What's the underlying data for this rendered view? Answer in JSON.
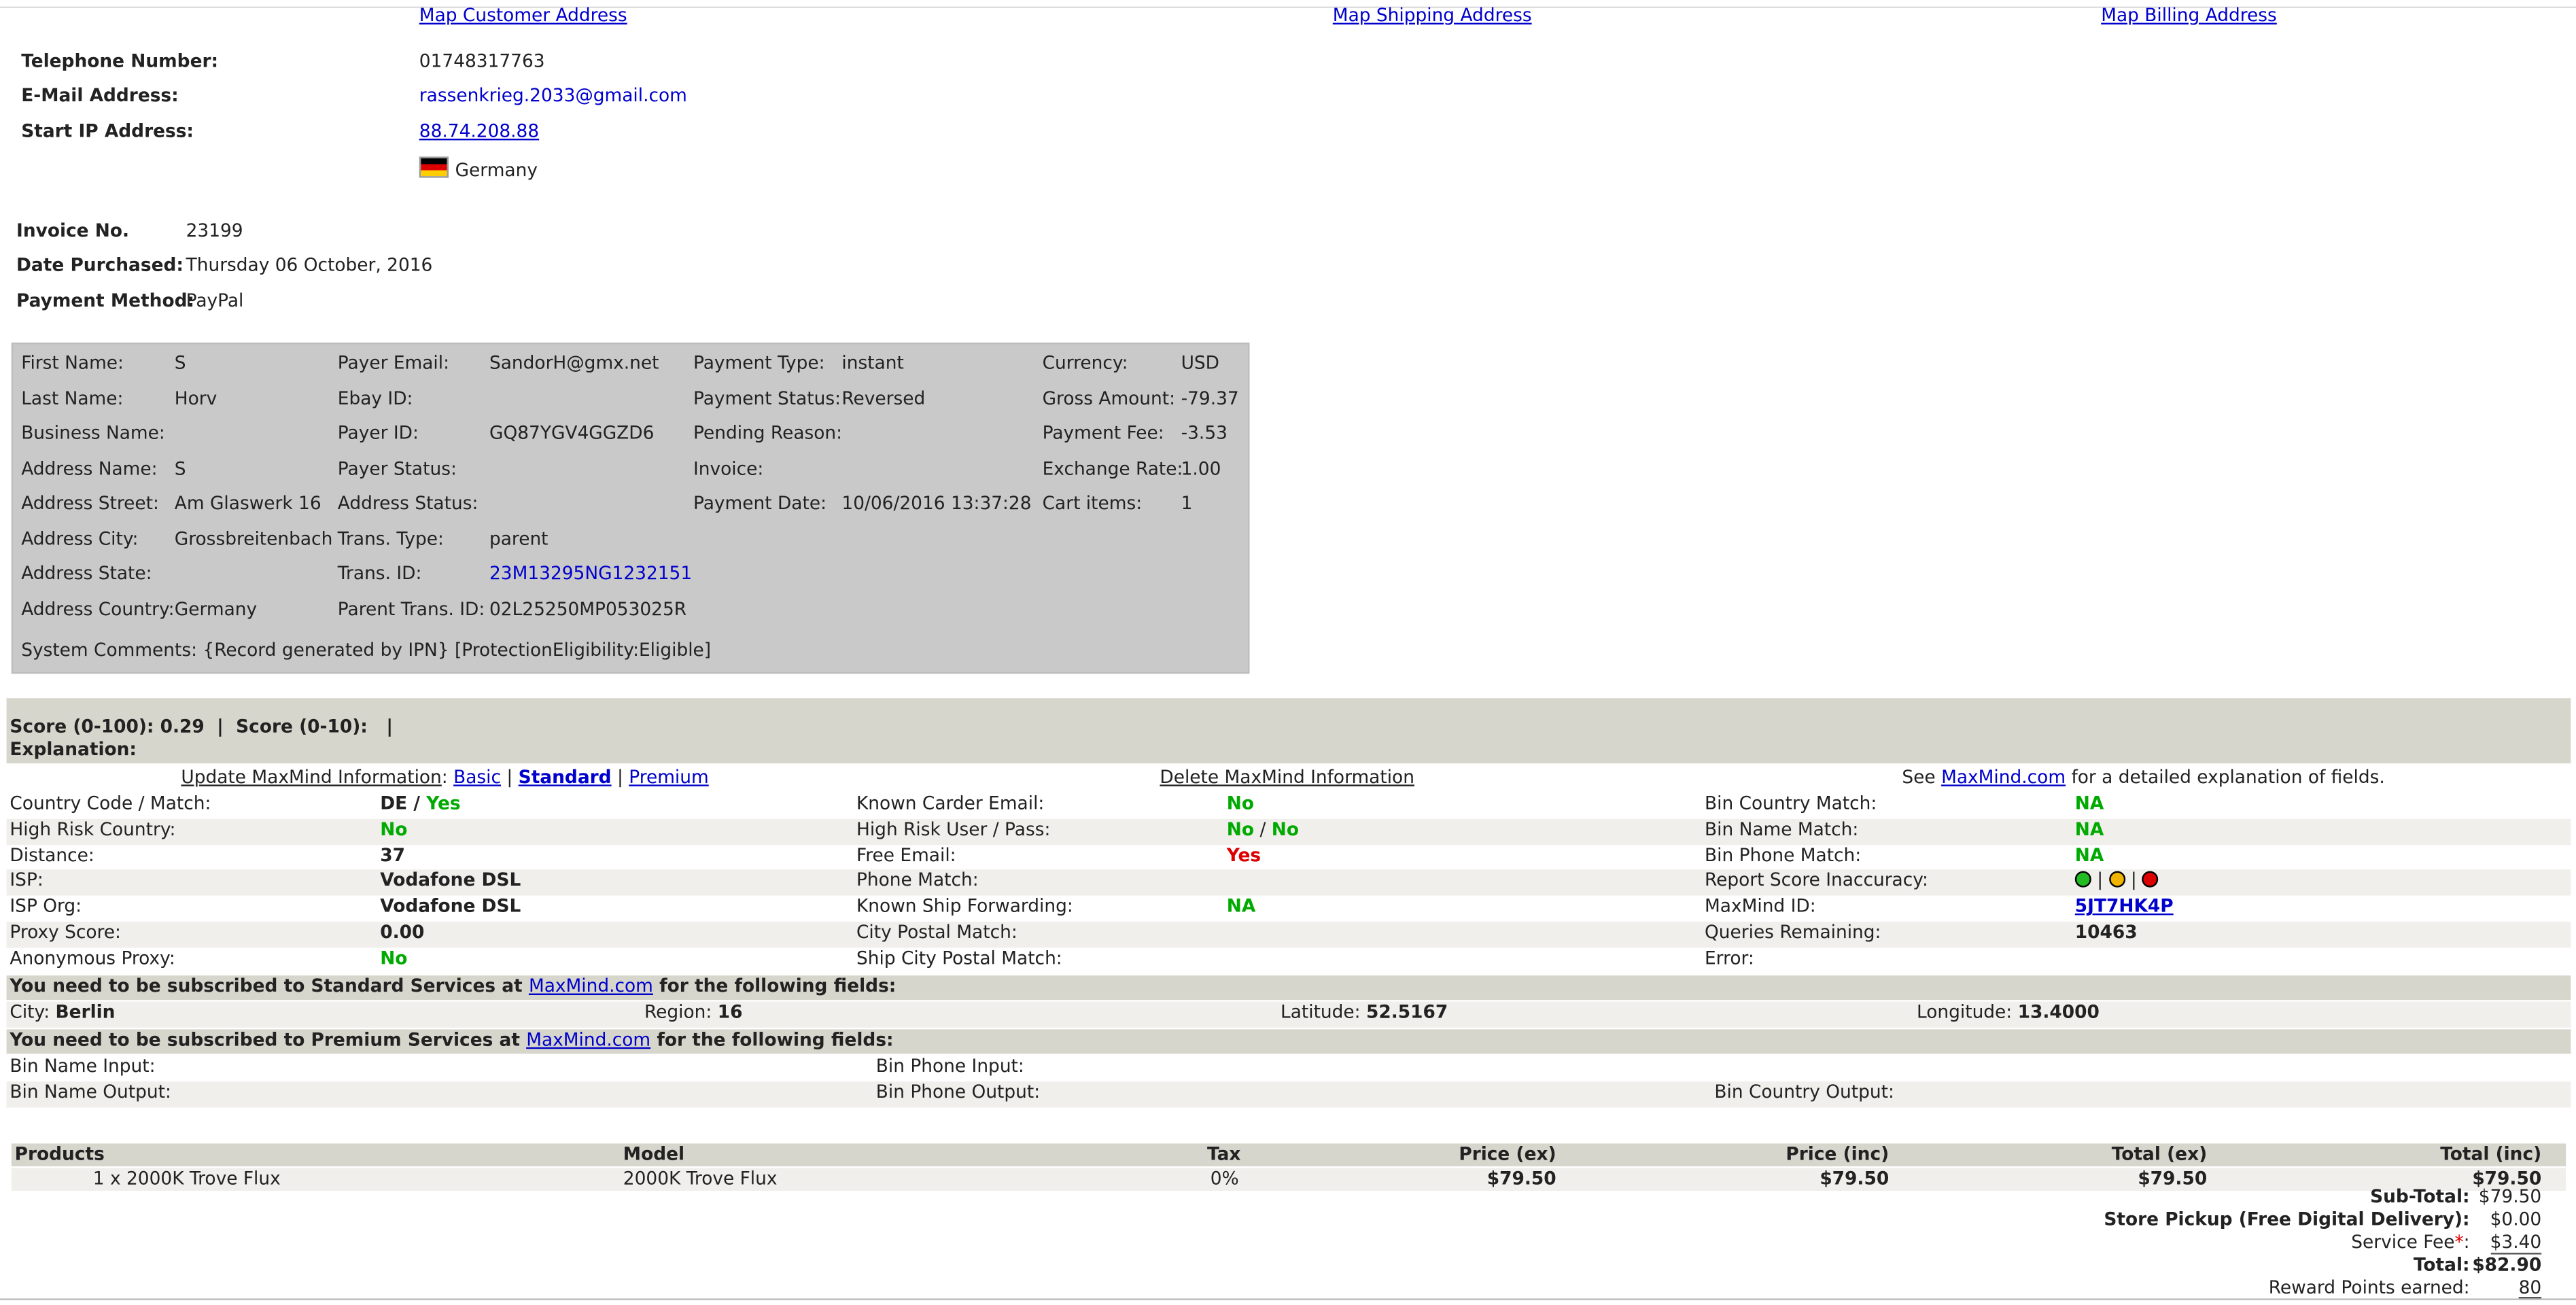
{
  "map_links": {
    "customer": "Map Customer Address",
    "shipping": "Map Shipping Address",
    "billing": "Map Billing Address"
  },
  "customer": {
    "telephone_label": "Telephone Number:",
    "telephone": "01748317763",
    "email_label": "E-Mail Address:",
    "email": "rassenkrieg.2033@gmail.com",
    "ip_label": "Start IP Address:",
    "ip": "88.74.208.88",
    "country": "Germany"
  },
  "invoice": {
    "invoice_label": "Invoice No.",
    "invoice_no": "23199",
    "date_label": "Date Purchased:",
    "date": "Thursday 06 October, 2016",
    "payment_label": "Payment Method:",
    "payment": "PayPal"
  },
  "paypal": {
    "col1": [
      [
        "First Name:",
        "S"
      ],
      [
        "Last Name:",
        "Horv"
      ],
      [
        "Business Name:",
        ""
      ],
      [
        "Address Name:",
        "S"
      ],
      [
        "Address Street:",
        "Am Glaswerk 16"
      ],
      [
        "Address City:",
        "Grossbreitenbach"
      ],
      [
        "Address State:",
        ""
      ],
      [
        "Address Country:",
        "Germany"
      ]
    ],
    "col2": [
      [
        "Payer Email:",
        "SandorH@gmx.net"
      ],
      [
        "Ebay ID:",
        ""
      ],
      [
        "Payer ID:",
        "GQ87YGV4GGZD6"
      ],
      [
        "Payer Status:",
        ""
      ],
      [
        "Address Status:",
        ""
      ],
      [
        "Trans. Type:",
        "parent"
      ],
      [
        "Trans. ID:",
        "23M13295NG1232151"
      ],
      [
        "Parent Trans. ID:",
        "02L25250MP053025R"
      ]
    ],
    "col3": [
      [
        "Payment Type:",
        "instant"
      ],
      [
        "Payment Status:",
        "Reversed"
      ],
      [
        "Pending Reason:",
        ""
      ],
      [
        "Invoice:",
        ""
      ],
      [
        "Payment Date:",
        "10/06/2016 13:37:28"
      ]
    ],
    "col4": [
      [
        "Currency:",
        "USD"
      ],
      [
        "Gross Amount:",
        "-79.37"
      ],
      [
        "Payment Fee:",
        "-3.53"
      ],
      [
        "Exchange Rate:",
        "1.00"
      ],
      [
        "Cart items:",
        "1"
      ]
    ],
    "system_comments": "System Comments: {Record generated by IPN} [ProtectionEligibility:Eligible]"
  },
  "maxmind": {
    "score_line": "Score (0-100): 0.29  |  Score (0-10):   |",
    "explanation": "Explanation:",
    "update_label": "Update MaxMind Information",
    "basic": "Basic",
    "standard": "Standard",
    "premium": "Premium",
    "delete_label": "Delete MaxMind Information",
    "see": "See",
    "see_link": "MaxMind.com",
    "see_tail": "for a detailed explanation of fields.",
    "rows": [
      {
        "l1": "Country Code / Match:",
        "l2": "Known Carder Email:",
        "v2": "No",
        "l3": "Bin Country Match:",
        "v3": "NA"
      },
      {
        "l1": "High Risk Country:",
        "v1": "No",
        "l2": "High Risk User / Pass:",
        "l3": "Bin Name Match:",
        "v3": "NA"
      },
      {
        "l1": "Distance:",
        "v1": "37",
        "l2": "Free Email:",
        "v2": "Yes",
        "l3": "Bin Phone Match:",
        "v3": "NA"
      },
      {
        "l1": "ISP:",
        "v1": "Vodafone DSL",
        "l2": "Phone Match:",
        "v2": "",
        "l3": "Report Score Inaccuracy:"
      },
      {
        "l1": "ISP Org:",
        "v1": "Vodafone DSL",
        "l2": "Known Ship Forwarding:",
        "v2": "NA",
        "l3": "MaxMind ID:",
        "v3": "5JT7HK4P"
      },
      {
        "l1": "Proxy Score:",
        "v1": "0.00",
        "l2": "City Postal Match:",
        "v2": "",
        "l3": "Queries Remaining:",
        "v3": "10463"
      },
      {
        "l1": "Anonymous Proxy:",
        "v1": "No",
        "l2": "Ship City Postal Match:",
        "v2": "",
        "l3": "Error:",
        "v3": ""
      }
    ],
    "country_code": "DE",
    "country_slash": "/",
    "country_match": "Yes",
    "hrup_a": "No",
    "hrup_slash": "/",
    "hrup_b": "No",
    "standard_msg_a": "You need to be subscribed to Standard Services at",
    "standard_msg_link": "MaxMind.com",
    "standard_msg_b": "for the following fields:",
    "city_label": "City:",
    "city": "Berlin",
    "region_label": "Region:",
    "region": "16",
    "lat_label": "Latitude:",
    "lat": "52.5167",
    "lon_label": "Longitude:",
    "lon": "13.4000",
    "premium_msg_a": "You need to be subscribed to Premium Services at",
    "premium_msg_link": "MaxMind.com",
    "premium_msg_b": "for the following fields:",
    "bin_name_input": "Bin Name Input:",
    "bin_phone_input": "Bin Phone Input:",
    "bin_name_output": "Bin Name Output:",
    "bin_phone_output": "Bin Phone Output:",
    "bin_country_output": "Bin Country Output:"
  },
  "products": {
    "headers": [
      "Products",
      "Model",
      "Tax",
      "Price (ex)",
      "Price (inc)",
      "Total (ex)",
      "Total (inc)"
    ],
    "row": {
      "name": "1 x 2000K Trove Flux",
      "model": "2000K Trove Flux",
      "tax": "0%",
      "price_ex": "$79.50",
      "price_inc": "$79.50",
      "total_ex": "$79.50",
      "total_inc": "$79.50"
    }
  },
  "totals": {
    "subtotal_label": "Sub-Total:",
    "subtotal": "$79.50",
    "pickup_label": "Store Pickup (Free Digital Delivery):",
    "pickup": "$0.00",
    "service_label": "Service Fee",
    "service_star": "*",
    ":": ":",
    "service": "$3.40",
    "total_label": "Total:",
    "total": "$82.90",
    "reward_label": "Reward Points earned:",
    "reward": "80"
  }
}
